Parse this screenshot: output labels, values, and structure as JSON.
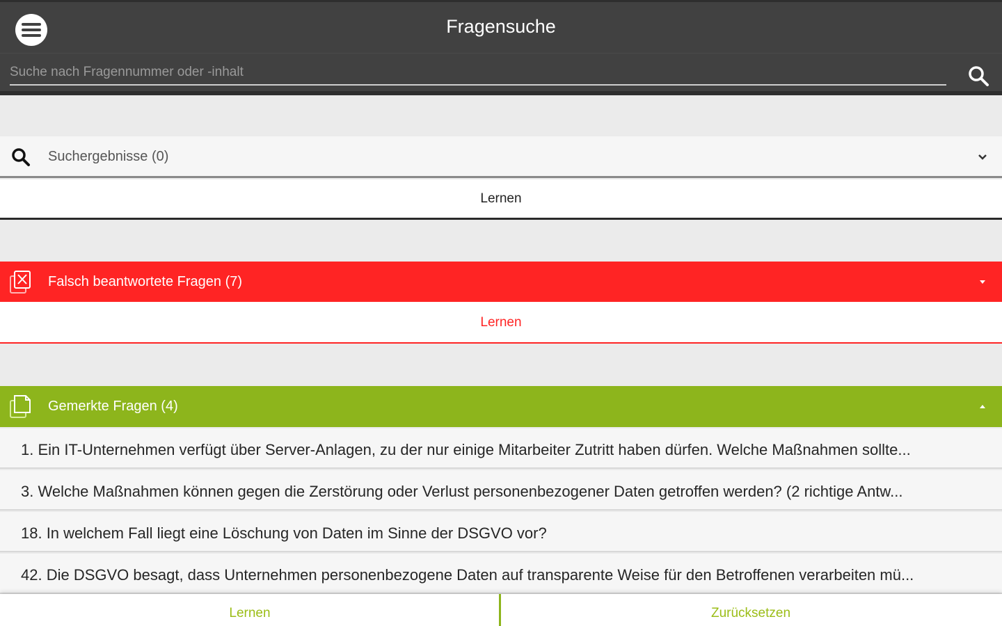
{
  "header": {
    "title": "Fragensuche",
    "search_placeholder": "Suche nach Fragennummer oder -inhalt",
    "menu_icon": "hamburger-menu-icon",
    "search_icon": "search-icon"
  },
  "sections": {
    "search": {
      "label": "Suchergebnisse (0)",
      "icon": "search-icon",
      "learn_label": "Lernen"
    },
    "wrong": {
      "label": "Falsch beantwortete Fragen (7)",
      "icon": "wrong-answers-icon",
      "learn_label": "Lernen",
      "color": "#ff2424"
    },
    "marked": {
      "label": "Gemerkte Fragen (4)",
      "icon": "bookmarked-pages-icon",
      "color": "#8db51c",
      "items": [
        "1. Ein IT-Unternehmen verfügt über Server-Anlagen, zu der nur einige Mitarbeiter Zutritt haben dürfen. Welche Maßnahmen sollte...",
        "3. Welche Maßnahmen können gegen die Zerstörung oder Verlust personenbezogener Daten getroffen werden? (2 richtige Antw...",
        "18. In welchem Fall liegt eine Löschung von Daten im Sinne der DSGVO vor?",
        "42. Die DSGVO besagt, dass Unternehmen personenbezogene Daten auf transparente Weise für den Betroffenen verarbeiten mü..."
      ]
    }
  },
  "bottom": {
    "learn_label": "Lernen",
    "reset_label": "Zurücksetzen"
  }
}
